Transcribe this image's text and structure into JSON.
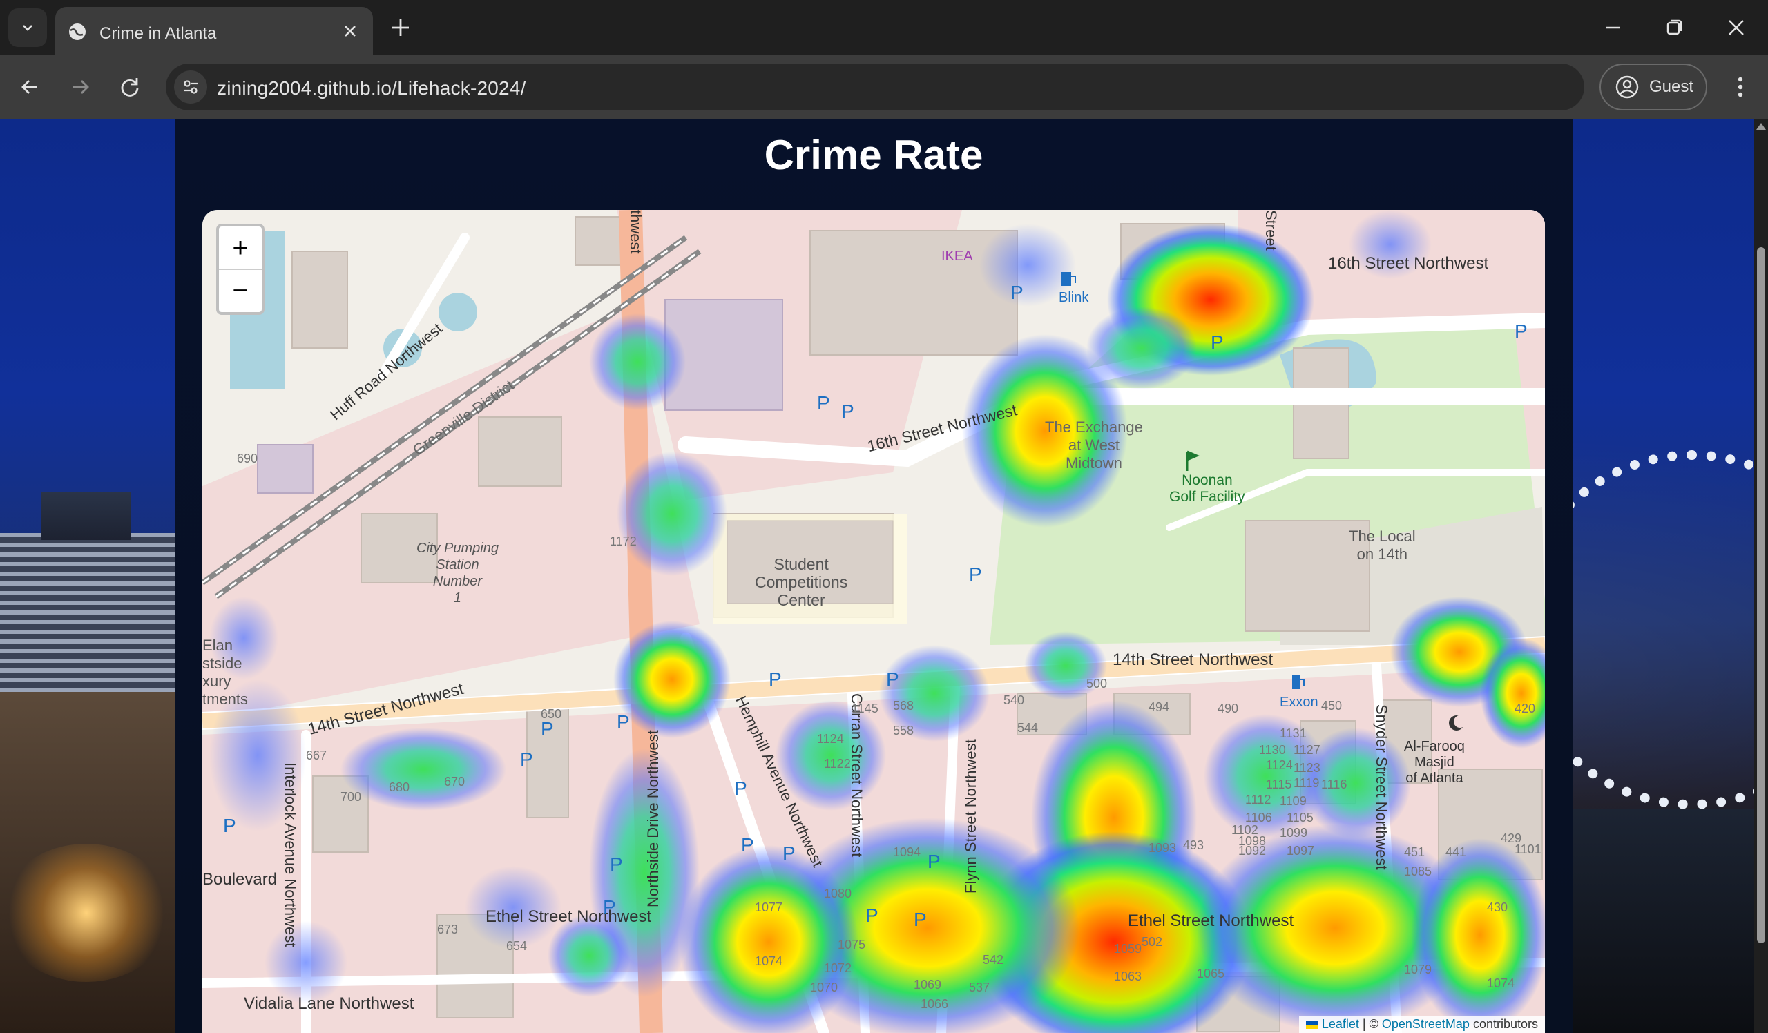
{
  "browser": {
    "tab_title": "Crime in Atlanta",
    "url": "zining2004.github.io/Lifehack-2024/",
    "profile_label": "Guest"
  },
  "page": {
    "title": "Crime Rate"
  },
  "map": {
    "zoom_in_label": "+",
    "zoom_out_label": "−",
    "attribution": {
      "leaflet": "Leaflet",
      "separator": " | © ",
      "osm": "OpenStreetMap",
      "suffix": " contributors"
    },
    "street_labels": {
      "s16th_ne": "16th Street Northwest",
      "s16th_mid": "16th Street Northwest",
      "s14th_main": "14th Street Northwest",
      "s14th_left": "14th Street Northwest",
      "huff": "Huff Road Northwest",
      "greenville": "Greenville District",
      "hemphill": "Hemphill Avenue Northwest",
      "curran": "Curran Street Northwest",
      "flynn": "Flynn Street Northwest",
      "northside": "Northside Drive Northwest",
      "interlock": "Interlock Avenue Northwest",
      "snyder": "Snyder Street Northwest",
      "ethel_left": "Ethel Street Northwest",
      "ethel_right": "Ethel Street Northwest",
      "vidalia": "Vidalia Lane Northwest",
      "boulevard": "Boulevard",
      "street_top": "Street",
      "northwest_top": "thwest"
    },
    "place_labels": {
      "ikea": "IKEA",
      "blink": "Blink",
      "exchange": "The Exchange\nat West\nMidtown",
      "noonan": "Noonan\nGolf Facility",
      "local": "The Local\non 14th",
      "student": "Student\nCompetitions\nCenter",
      "pumping": "City Pumping\nStation\nNumber\n1",
      "exxon": "Exxon",
      "masjid": "Al-Farooq\nMasjid\nof Atlanta",
      "elan": "Elan\nstside\nxury\ntments"
    },
    "numbers": [
      "690",
      "1172",
      "667",
      "650",
      "700",
      "680",
      "670",
      "673",
      "654",
      "1145",
      "568",
      "558",
      "1124",
      "1122",
      "540",
      "544",
      "500",
      "494",
      "490",
      "450",
      "420",
      "1131",
      "1130",
      "1127",
      "1124",
      "1123",
      "1119",
      "1115",
      "1116",
      "1112",
      "1109",
      "1106",
      "1105",
      "1102",
      "1099",
      "1098",
      "1097",
      "1094",
      "1093",
      "1092",
      "1085",
      "1080",
      "1077",
      "1075",
      "1074",
      "1072",
      "1070",
      "1069",
      "1066",
      "1063",
      "1059",
      "1065",
      "1079",
      "1074",
      "502",
      "493",
      "451",
      "441",
      "430",
      "429",
      "1101",
      "537",
      "542"
    ]
  }
}
